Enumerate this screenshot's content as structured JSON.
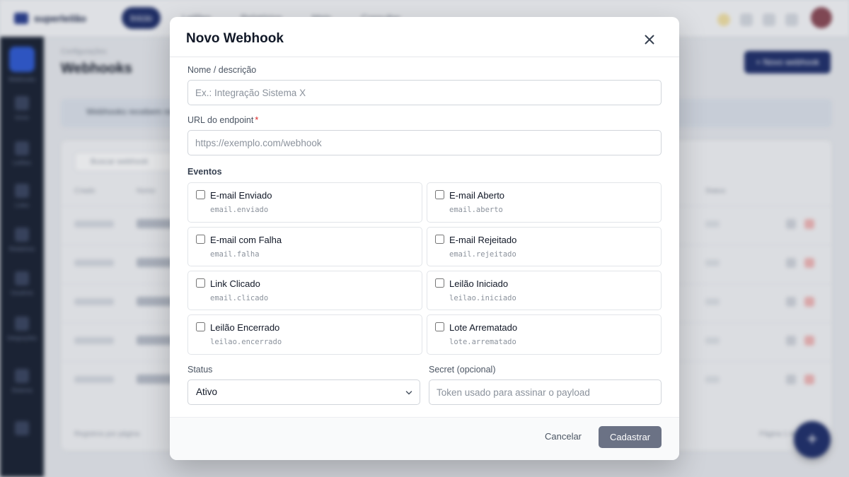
{
  "background": {
    "app_name": "superleilão",
    "nav": [
      "Início",
      "Leilões",
      "Relatórios",
      "Mais",
      "Consultar"
    ],
    "breadcrumb": "Configurações",
    "page_title": "Webhooks",
    "new_button": "+ Novo webhook",
    "info_text": "Webhooks recebem notificações de eventos em tempo real.",
    "search_placeholder": "Buscar webhook",
    "table_headers": [
      "Criado",
      "Nome",
      "Status"
    ],
    "footer_left": "Registros por página",
    "footer_right": "Página 1 de 1",
    "sidebar": [
      "Webhooks",
      "Início",
      "Leilões",
      "Lotes",
      "Relatórios",
      "Usuários",
      "Integrações",
      "Sistema"
    ]
  },
  "modal": {
    "title": "Novo Webhook",
    "name_field": {
      "label": "Nome / descrição",
      "placeholder": "Ex.: Integração Sistema X"
    },
    "url_field": {
      "label": "URL do endpoint",
      "required_mark": "*",
      "placeholder": "https://exemplo.com/webhook"
    },
    "events_label": "Eventos",
    "events": [
      {
        "label": "E-mail Enviado",
        "code": "email.enviado"
      },
      {
        "label": "E-mail Aberto",
        "code": "email.aberto"
      },
      {
        "label": "E-mail com Falha",
        "code": "email.falha"
      },
      {
        "label": "E-mail Rejeitado",
        "code": "email.rejeitado"
      },
      {
        "label": "Link Clicado",
        "code": "email.clicado"
      },
      {
        "label": "Leilão Iniciado",
        "code": "leilao.iniciado"
      },
      {
        "label": "Leilão Encerrado",
        "code": "leilao.encerrado"
      },
      {
        "label": "Lote Arrematado",
        "code": "lote.arrematado"
      }
    ],
    "status_field": {
      "label": "Status",
      "value": "Ativo"
    },
    "secret_field": {
      "label": "Secret (opcional)",
      "placeholder": "Token usado para assinar o payload"
    },
    "cancel_label": "Cancelar",
    "submit_label": "Cadastrar"
  }
}
